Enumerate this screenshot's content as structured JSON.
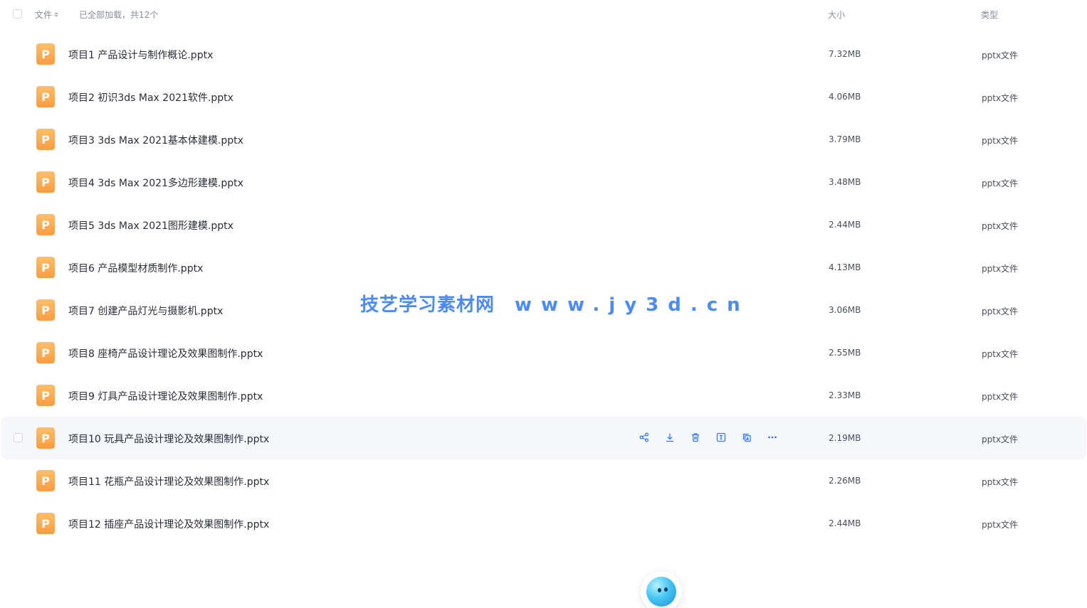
{
  "header": {
    "file_label": "文件",
    "status": "已全部加载，共12个",
    "size_label": "大小",
    "type_label": "类型"
  },
  "files": [
    {
      "name": "项目1 产品设计与制作概论.pptx",
      "size": "7.32MB",
      "type": "pptx文件"
    },
    {
      "name": "项目2 初识3ds Max 2021软件.pptx",
      "size": "4.06MB",
      "type": "pptx文件"
    },
    {
      "name": "项目3 3ds Max 2021基本体建模.pptx",
      "size": "3.79MB",
      "type": "pptx文件"
    },
    {
      "name": "项目4 3ds Max 2021多边形建模.pptx",
      "size": "3.48MB",
      "type": "pptx文件"
    },
    {
      "name": "项目5 3ds Max 2021图形建模.pptx",
      "size": "2.44MB",
      "type": "pptx文件"
    },
    {
      "name": "项目6 产品模型材质制作.pptx",
      "size": "4.13MB",
      "type": "pptx文件"
    },
    {
      "name": "项目7 创建产品灯光与摄影机.pptx",
      "size": "3.06MB",
      "type": "pptx文件"
    },
    {
      "name": "项目8 座椅产品设计理论及效果图制作.pptx",
      "size": "2.55MB",
      "type": "pptx文件"
    },
    {
      "name": "项目9 灯具产品设计理论及效果图制作.pptx",
      "size": "2.33MB",
      "type": "pptx文件"
    },
    {
      "name": "项目10 玩具产品设计理论及效果图制作.pptx",
      "size": "2.19MB",
      "type": "pptx文件"
    },
    {
      "name": "项目11 花瓶产品设计理论及效果图制作.pptx",
      "size": "2.26MB",
      "type": "pptx文件"
    },
    {
      "name": "项目12 插座产品设计理论及效果图制作.pptx",
      "size": "2.44MB",
      "type": "pptx文件"
    }
  ],
  "file_icon_letter": "P",
  "hover_row_index": 9,
  "row_actions": [
    "share-icon",
    "download-icon",
    "delete-icon",
    "rename-icon",
    "copy-icon",
    "more-icon"
  ],
  "watermark": {
    "site_name": "技艺学习素材网",
    "url": "www.jy3d.cn"
  },
  "colors": {
    "accent": "#4c8bf5",
    "icon_orange": "#ff9c3f",
    "hover_bg": "#f5f7fb",
    "action_icon": "#3b7cf0"
  }
}
